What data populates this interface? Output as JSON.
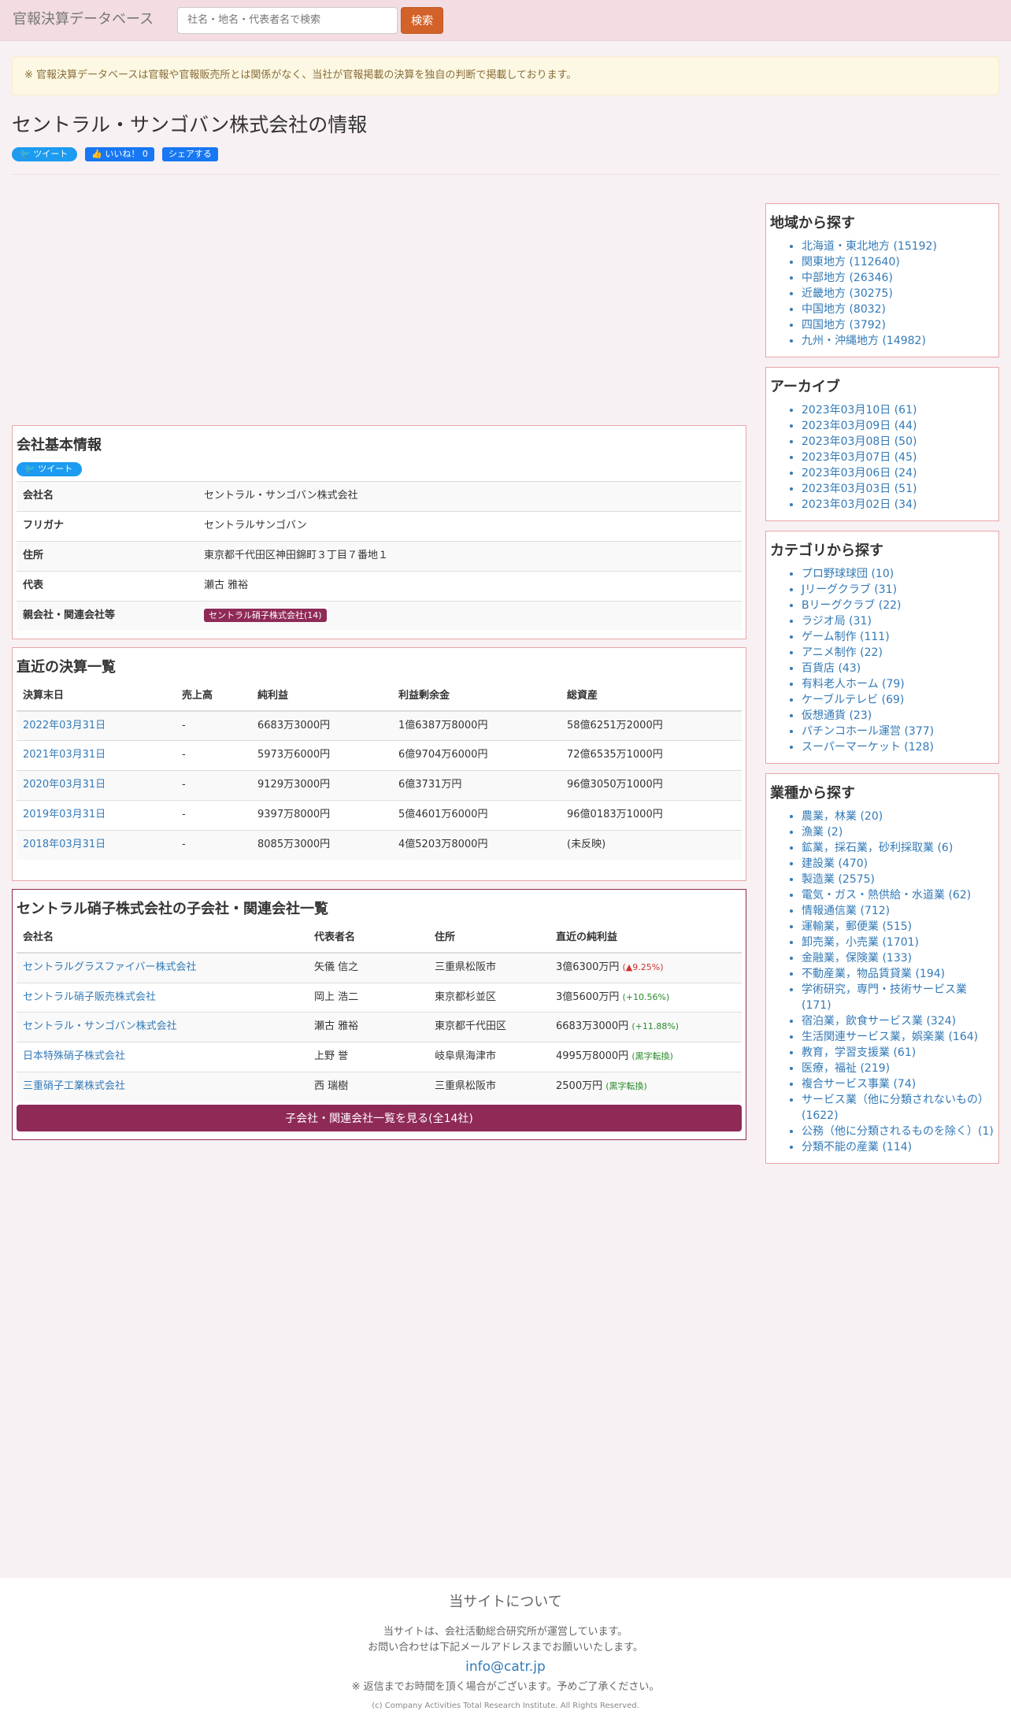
{
  "nav": {
    "brand": "官報決算データベース",
    "search_placeholder": "社名・地名・代表者名で検索",
    "search_button": "検索"
  },
  "notice": "※ 官報決算データベースは官報や官報販売所とは関係がなく、当社が官報掲載の決算を独自の判断で掲載しております。",
  "page_title": "セントラル・サンゴバン株式会社の情報",
  "social": {
    "tweet": "ツイート",
    "like": "いいね！ 0",
    "share": "シェアする"
  },
  "basic_info": {
    "heading": "会社基本情報",
    "tweet": "ツイート",
    "rows": [
      {
        "key": "会社名",
        "value": "セントラル・サンゴバン株式会社"
      },
      {
        "key": "フリガナ",
        "value": "セントラルサンゴバン"
      },
      {
        "key": "住所",
        "value": "東京都千代田区神田錦町３丁目７番地１"
      },
      {
        "key": "代表",
        "value": "瀬古 雅裕"
      }
    ],
    "parent_key": "親会社・関連会社等",
    "parent_badge": "セントラル硝子株式会社(14)"
  },
  "financials": {
    "heading": "直近の決算一覧",
    "headers": [
      "決算末日",
      "売上高",
      "純利益",
      "利益剰余金",
      "総資産"
    ],
    "rows": [
      [
        "2022年03月31日",
        "-",
        "6683万3000円",
        "1億6387万8000円",
        "58億6251万2000円"
      ],
      [
        "2021年03月31日",
        "-",
        "5973万6000円",
        "6億9704万6000円",
        "72億6535万1000円"
      ],
      [
        "2020年03月31日",
        "-",
        "9129万3000円",
        "6億3731万円",
        "96億3050万1000円"
      ],
      [
        "2019年03月31日",
        "-",
        "9397万8000円",
        "5億4601万6000円",
        "96億0183万1000円"
      ],
      [
        "2018年03月31日",
        "-",
        "8085万3000円",
        "4億5203万8000円",
        "(未反映)"
      ]
    ]
  },
  "subsidiaries": {
    "heading": "セントラル硝子株式会社の子会社・関連会社一覧",
    "headers": [
      "会社名",
      "代表者名",
      "住所",
      "直近の純利益"
    ],
    "rows": [
      {
        "name": "セントラルグラスファイバー株式会社",
        "rep": "矢儀 信之",
        "addr": "三重県松阪市",
        "profit": "3億6300万円",
        "change": "▲9.25%",
        "dir": "down"
      },
      {
        "name": "セントラル硝子販売株式会社",
        "rep": "岡上 浩二",
        "addr": "東京都杉並区",
        "profit": "3億5600万円",
        "change": "+10.56%",
        "dir": "up"
      },
      {
        "name": "セントラル・サンゴバン株式会社",
        "rep": "瀬古 雅裕",
        "addr": "東京都千代田区",
        "profit": "6683万3000円",
        "change": "+11.88%",
        "dir": "up"
      },
      {
        "name": "日本特殊硝子株式会社",
        "rep": "上野 誉",
        "addr": "岐阜県海津市",
        "profit": "4995万8000円",
        "change": "黒字転換",
        "dir": "up"
      },
      {
        "name": "三重硝子工業株式会社",
        "rep": "西 瑞樹",
        "addr": "三重県松阪市",
        "profit": "2500万円",
        "change": "黒字転換",
        "dir": "up"
      }
    ],
    "more_button": "子会社・関連会社一覧を見る(全14社)"
  },
  "sidebar": {
    "region": {
      "heading": "地域から探す",
      "items": [
        "北海道・東北地方 (15192)",
        "関東地方 (112640)",
        "中部地方 (26346)",
        "近畿地方 (30275)",
        "中国地方 (8032)",
        "四国地方 (3792)",
        "九州・沖縄地方 (14982)"
      ]
    },
    "archive": {
      "heading": "アーカイブ",
      "items": [
        "2023年03月10日 (61)",
        "2023年03月09日 (44)",
        "2023年03月08日 (50)",
        "2023年03月07日 (45)",
        "2023年03月06日 (24)",
        "2023年03月03日 (51)",
        "2023年03月02日 (34)"
      ]
    },
    "category": {
      "heading": "カテゴリから探す",
      "items": [
        "プロ野球球団 (10)",
        "Jリーグクラブ (31)",
        "Bリーグクラブ (22)",
        "ラジオ局 (31)",
        "ゲーム制作 (111)",
        "アニメ制作 (22)",
        "百貨店 (43)",
        "有料老人ホーム (79)",
        "ケーブルテレビ (69)",
        "仮想通貨 (23)",
        "パチンコホール運営 (377)",
        "スーパーマーケット (128)"
      ]
    },
    "industry": {
      "heading": "業種から探す",
      "items": [
        "農業，林業 (20)",
        "漁業 (2)",
        "鉱業，採石業，砂利採取業 (6)",
        "建設業 (470)",
        "製造業 (2575)",
        "電気・ガス・熱供給・水道業 (62)",
        "情報通信業 (712)",
        "運輸業，郵便業 (515)",
        "卸売業，小売業 (1701)",
        "金融業，保険業 (133)",
        "不動産業，物品賃貸業 (194)",
        "学術研究，専門・技術サービス業 (171)",
        "宿泊業，飲食サービス業 (324)",
        "生活関連サービス業，娯楽業 (164)",
        "教育，学習支援業 (61)",
        "医療，福祉 (219)",
        "複合サービス事業 (74)",
        "サービス業（他に分類されないもの）(1622)",
        "公務（他に分類されるものを除く）(1)",
        "分類不能の産業 (114)"
      ]
    }
  },
  "footer": {
    "heading": "当サイトについて",
    "line1": "当サイトは、会社活動総合研究所が運営しています。",
    "line2": "お問い合わせは下記メールアドレスまでお願いいたします。",
    "email": "info@catr.jp",
    "note": "※ 返信までお時間を頂く場合がございます。予めご了承ください。",
    "copyright": "(c) Company Activities Total Research Institute. All Rights Reserved."
  }
}
